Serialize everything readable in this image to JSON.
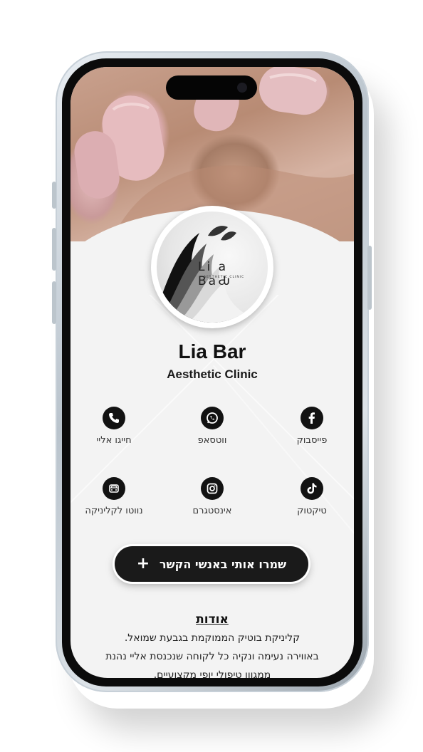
{
  "profile": {
    "name": "Lia Bar",
    "subtitle": "Aesthetic Clinic",
    "logo_text": "Li a BaԂ",
    "logo_subtext": "AESTHETIC CLINIC"
  },
  "contacts": [
    {
      "label": "פייסבוק",
      "icon": "facebook-icon"
    },
    {
      "label": "ווטסאפ",
      "icon": "whatsapp-icon"
    },
    {
      "label": "חייגו אליי",
      "icon": "phone-icon"
    },
    {
      "label": "טיקטוק",
      "icon": "tiktok-icon"
    },
    {
      "label": "אינסטגרם",
      "icon": "instagram-icon"
    },
    {
      "label": "נווטו לקליניקה",
      "icon": "car-icon"
    }
  ],
  "save_button": {
    "label": "שמרו אותי באנשי הקשר",
    "plus": "+"
  },
  "about": {
    "title": "אודות",
    "lines": [
      "קליניקת בוטיק הממוקמת בגבעת שמואל.",
      "באווירה נעימה ונקיה כל לקוחה שנכנסת אליי נהנת",
      "ממגוון טיפולי יופי מקצועיים."
    ]
  },
  "colors": {
    "button_bg": "#1a1a1a",
    "icon_bg": "#121212",
    "background": "#f3f3f3"
  }
}
